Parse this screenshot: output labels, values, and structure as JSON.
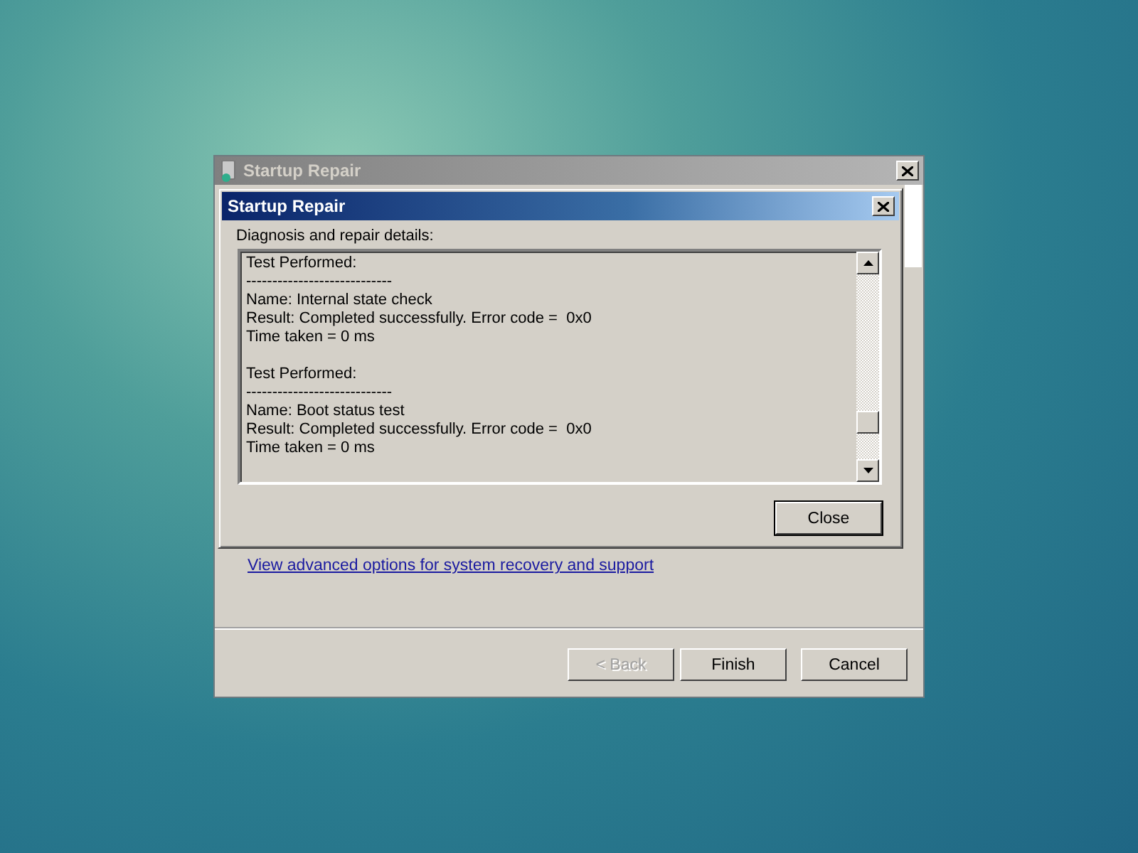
{
  "outer_window": {
    "title": "Startup Repair",
    "link": "View advanced options for system recovery and support",
    "buttons": [
      {
        "label": "< Back",
        "disabled": true
      },
      {
        "label": "Finish",
        "disabled": false
      },
      {
        "label": "Cancel",
        "disabled": false
      }
    ]
  },
  "details_dialog": {
    "title": "Startup Repair",
    "caption": "Diagnosis and repair details:",
    "tests": [
      {
        "heading": "Test Performed:",
        "rule": "----------------------------",
        "name": "Name: Internal state check",
        "result": "Result: Completed successfully. Error code =  0x0",
        "time": "Time taken = 0 ms"
      },
      {
        "heading": "Test Performed:",
        "rule": "----------------------------",
        "name": "Name: Boot status test",
        "result": "Result: Completed successfully. Error code =  0x0",
        "time": "Time taken = 0 ms"
      }
    ],
    "close_button": "Close"
  }
}
